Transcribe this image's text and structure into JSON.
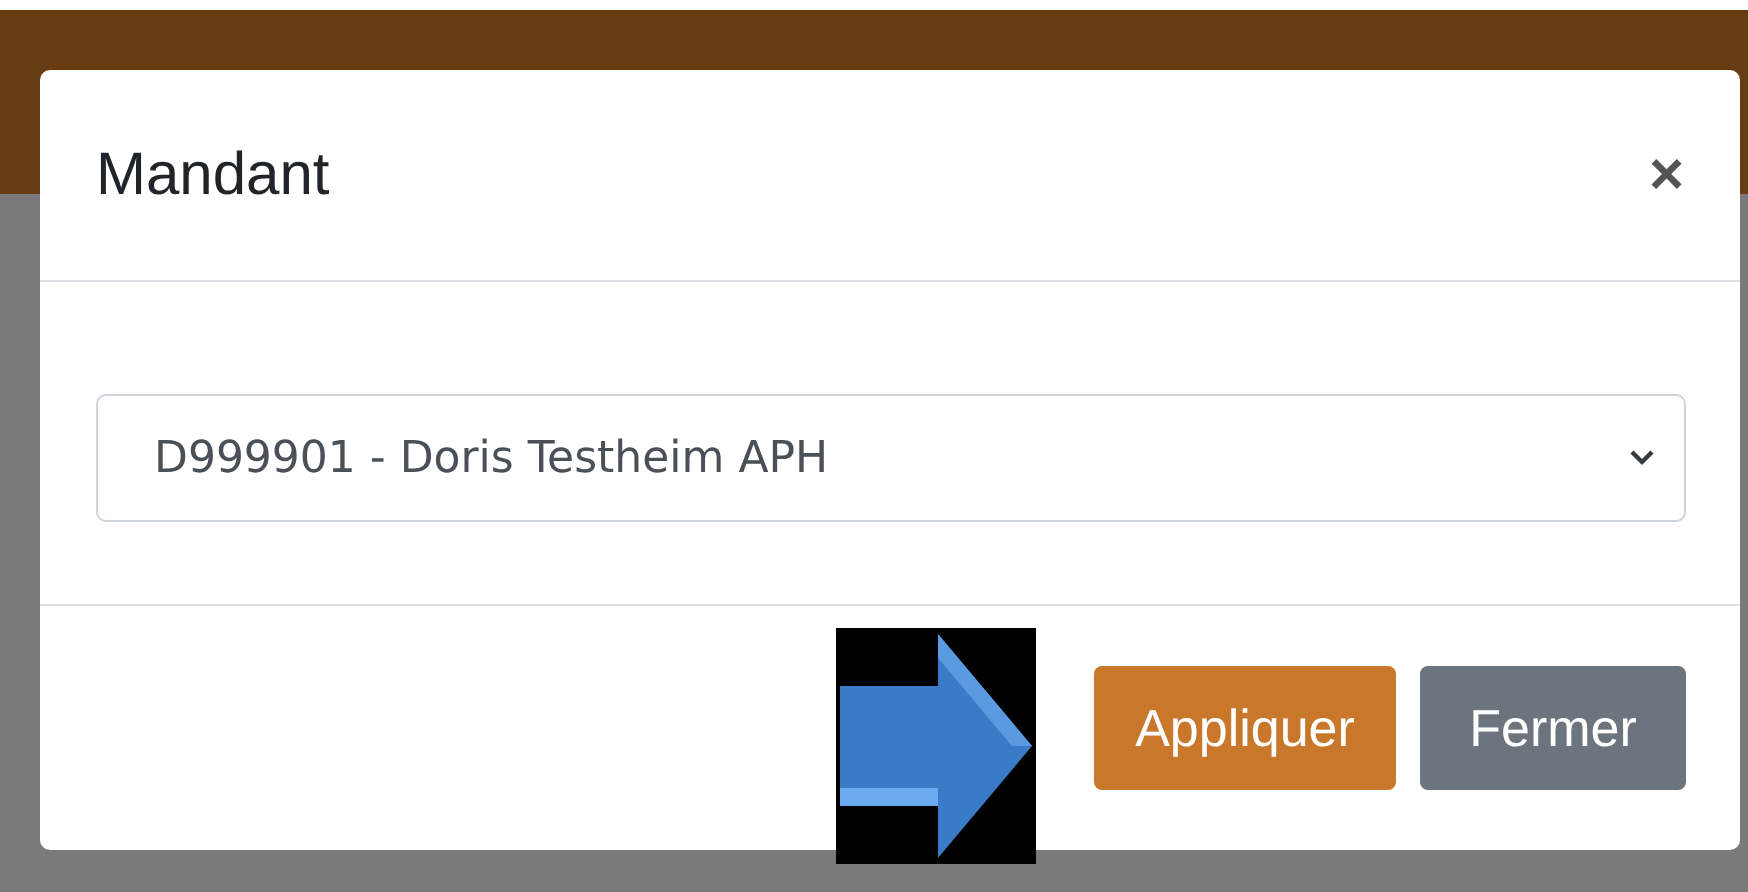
{
  "modal": {
    "title": "Mandant",
    "close": "×",
    "select": {
      "value": "D999901 - Doris Testheim APH"
    },
    "buttons": [
      {
        "label": "Appliquer",
        "kind": "primary"
      },
      {
        "label": "Fermer",
        "kind": "secondary"
      }
    ]
  }
}
